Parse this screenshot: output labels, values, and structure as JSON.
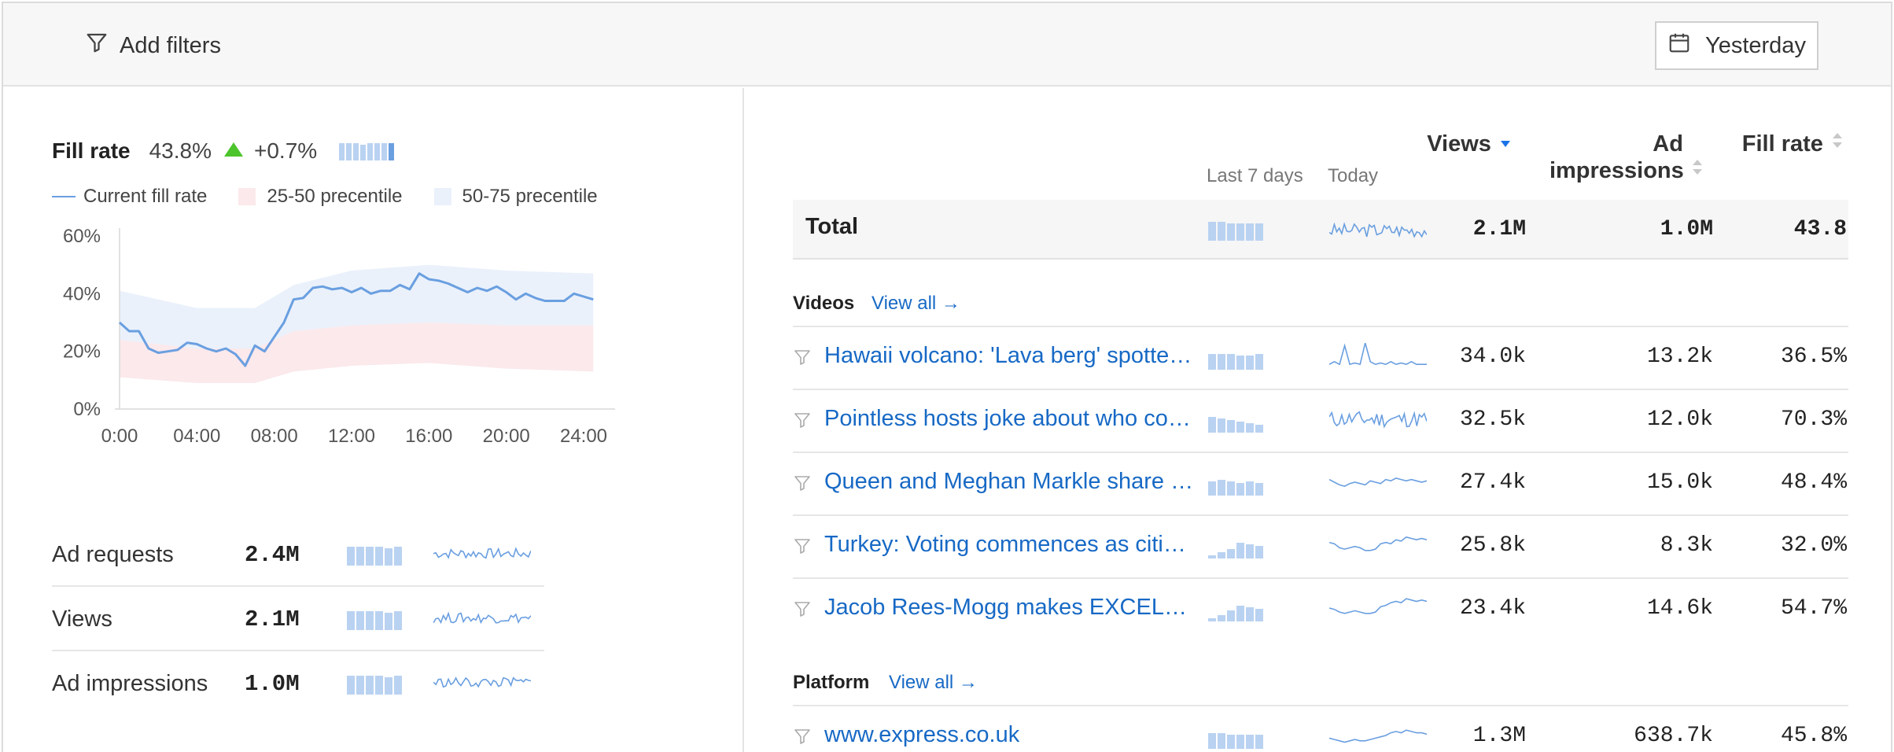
{
  "toolbar": {
    "add_filters_label": "Add filters",
    "date_label": "Yesterday"
  },
  "fill_rate": {
    "title": "Fill rate",
    "value": "43.8%",
    "delta": "+0.7%",
    "legend": {
      "current": "Current fill rate",
      "p25_50": "25-50 precentile",
      "p50_75": "50-75 precentile"
    },
    "colors": {
      "line": "#6a9fe0",
      "band_low": "#fbe9ec",
      "band_high": "#eaf1fb",
      "up": "#4cc42b"
    }
  },
  "chart_data": {
    "type": "line",
    "x": [
      "0:00",
      "04:00",
      "08:00",
      "12:00",
      "16:00",
      "20:00",
      "24:00"
    ],
    "xlim": [
      0,
      24
    ],
    "ylim": [
      0,
      60
    ],
    "yticks": [
      "60%",
      "40%",
      "20%",
      "0%"
    ],
    "series": [
      {
        "name": "Current fill rate",
        "points": [
          [
            0,
            30
          ],
          [
            0.5,
            27
          ],
          [
            1,
            27
          ],
          [
            1.5,
            21
          ],
          [
            2,
            19.5
          ],
          [
            2.5,
            20
          ],
          [
            3,
            20.5
          ],
          [
            3.5,
            23
          ],
          [
            4,
            22.5
          ],
          [
            4.5,
            21
          ],
          [
            5,
            20
          ],
          [
            5.5,
            21
          ],
          [
            6,
            19
          ],
          [
            6.5,
            15
          ],
          [
            7,
            22
          ],
          [
            7.5,
            20
          ],
          [
            8,
            25
          ],
          [
            8.5,
            30
          ],
          [
            9,
            38
          ],
          [
            9.5,
            38.5
          ],
          [
            10,
            42
          ],
          [
            10.5,
            42.5
          ],
          [
            11,
            41.5
          ],
          [
            11.5,
            42
          ],
          [
            12,
            40.5
          ],
          [
            12.5,
            42
          ],
          [
            13,
            40
          ],
          [
            13.5,
            41
          ],
          [
            14,
            41
          ],
          [
            14.5,
            43
          ],
          [
            15,
            41.5
          ],
          [
            15.5,
            47
          ],
          [
            16,
            45
          ],
          [
            16.5,
            44.5
          ],
          [
            17,
            43.5
          ],
          [
            17.5,
            42
          ],
          [
            18,
            40.5
          ],
          [
            18.5,
            42
          ],
          [
            19,
            41
          ],
          [
            19.5,
            42.5
          ],
          [
            20,
            40.5
          ],
          [
            20.5,
            38
          ],
          [
            21,
            40
          ],
          [
            21.5,
            38.5
          ],
          [
            22,
            37.5
          ],
          [
            22.5,
            37.5
          ],
          [
            23,
            37.5
          ],
          [
            23.5,
            40
          ],
          [
            24,
            39
          ],
          [
            24.5,
            38
          ]
        ]
      },
      {
        "name": "25-50 precentile",
        "lower": [
          [
            0,
            11
          ],
          [
            4,
            9
          ],
          [
            7,
            9
          ],
          [
            9,
            13
          ],
          [
            12,
            15
          ],
          [
            16,
            16
          ],
          [
            20,
            14
          ],
          [
            24.5,
            13
          ]
        ],
        "upper": [
          [
            0,
            24
          ],
          [
            4,
            21
          ],
          [
            7,
            21
          ],
          [
            9,
            27
          ],
          [
            12,
            29
          ],
          [
            16,
            30
          ],
          [
            20,
            29
          ],
          [
            24.5,
            29
          ]
        ]
      },
      {
        "name": "50-75 precentile",
        "lower": [
          [
            0,
            24
          ],
          [
            4,
            21
          ],
          [
            7,
            21
          ],
          [
            9,
            27
          ],
          [
            12,
            29
          ],
          [
            16,
            30
          ],
          [
            20,
            29
          ],
          [
            24.5,
            29
          ]
        ],
        "upper": [
          [
            0,
            41
          ],
          [
            4,
            35
          ],
          [
            7,
            35
          ],
          [
            9,
            43
          ],
          [
            12,
            48
          ],
          [
            16,
            50
          ],
          [
            20,
            48
          ],
          [
            24.5,
            47
          ]
        ]
      }
    ]
  },
  "metrics": [
    {
      "name": "Ad requests",
      "value": "2.4M"
    },
    {
      "name": "Views",
      "value": "2.1M"
    },
    {
      "name": "Ad impressions",
      "value": "1.0M"
    }
  ],
  "table": {
    "headers": {
      "last7": "Last 7 days",
      "today": "Today",
      "views": "Views",
      "ad_impr": "Ad impressions",
      "fill_rate": "Fill rate"
    },
    "total": {
      "label": "Total",
      "views": "2.1M",
      "ad_impr": "1.0M",
      "fill_rate": "43.8"
    },
    "sections": [
      {
        "title": "Videos",
        "view_all": "View all →",
        "rows": [
          {
            "title": "Hawaii volcano: 'Lava berg' spotted...",
            "views": "34.0k",
            "ad_impr": "13.2k",
            "fill_rate": "36.5%"
          },
          {
            "title": "Pointless hosts joke about who coul...",
            "views": "32.5k",
            "ad_impr": "12.0k",
            "fill_rate": "70.3%"
          },
          {
            "title": "Queen and Meghan Markle share a...",
            "views": "27.4k",
            "ad_impr": "15.0k",
            "fill_rate": "48.4%"
          },
          {
            "title": "Turkey: Voting commences as citizen...",
            "views": "25.8k",
            "ad_impr": "8.3k",
            "fill_rate": "32.0%"
          },
          {
            "title": "Jacob Rees-Mogg makes EXCELLEN...",
            "views": "23.4k",
            "ad_impr": "14.6k",
            "fill_rate": "54.7%"
          }
        ]
      },
      {
        "title": "Platform",
        "view_all": "View all →",
        "rows": [
          {
            "title": "www.express.co.uk",
            "views": "1.3M",
            "ad_impr": "638.7k",
            "fill_rate": "45.8%"
          }
        ]
      }
    ]
  },
  "icons": {
    "filter": "filter-icon",
    "calendar": "calendar-icon",
    "sort_desc": "sort-desc-icon",
    "sort": "sort-icon",
    "up": "triangle-up-icon"
  }
}
